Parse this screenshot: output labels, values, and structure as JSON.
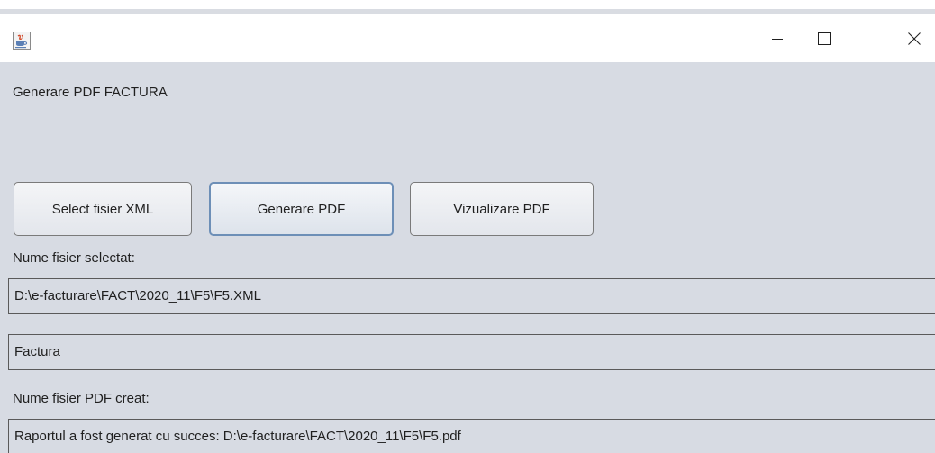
{
  "window": {
    "controls": {
      "minimize_icon": "minimize-icon",
      "maximize_icon": "maximize-icon",
      "close_icon": "close-icon"
    },
    "app_icon": "java-cup-icon"
  },
  "main": {
    "header": "Generare PDF FACTURA",
    "buttons": {
      "select_xml": "Select fisier XML",
      "generate_pdf": "Generare PDF",
      "view_pdf": "Vizualizare PDF"
    },
    "selected_file_label": "Nume fisier selectat:",
    "selected_file_value": "D:\\e-facturare\\FACT\\2020_11\\F5\\F5.XML",
    "document_type_value": "Factura",
    "pdf_created_label": "Nume fisier PDF creat:",
    "status_value": "Raportul a fost generat cu succes: D:\\e-facturare\\FACT\\2020_11\\F5\\F5.pdf"
  },
  "colors": {
    "window_background": "#d7dbe3",
    "focus_border": "#6d8fb7"
  }
}
